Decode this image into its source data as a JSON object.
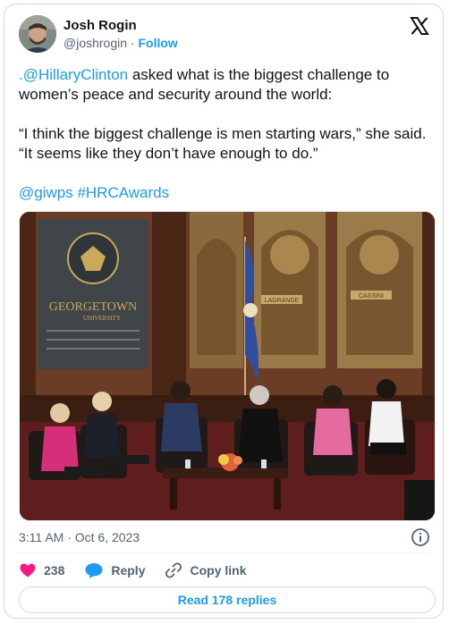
{
  "author": {
    "name": "Josh Rogin",
    "handle": "@joshrogin",
    "separator": "·",
    "follow_label": "Follow"
  },
  "tweet": {
    "mention": ".@HillaryClinton",
    "line1_rest": " asked what is the biggest challenge to women’s peace and security around the world:",
    "quote": "“I think the biggest challenge is men starting wars,” she said. “It seems like they don’t have enough to do.”",
    "tags": "@giwps #HRCAwards"
  },
  "photo": {
    "banner_title": "GEORGETOWN",
    "banner_subtitle": "UNIVERSITY",
    "plaque_left": "LAGRANGE",
    "plaque_right": "CASSINI"
  },
  "meta": {
    "timestamp": "3:11 AM · Oct 6, 2023"
  },
  "actions": {
    "likes": "238",
    "reply_label": "Reply",
    "copy_link_label": "Copy link"
  },
  "read_replies_label": "Read 178 replies",
  "colors": {
    "accent": "#1d9bf0",
    "like": "#f91880",
    "muted": "#536471"
  }
}
